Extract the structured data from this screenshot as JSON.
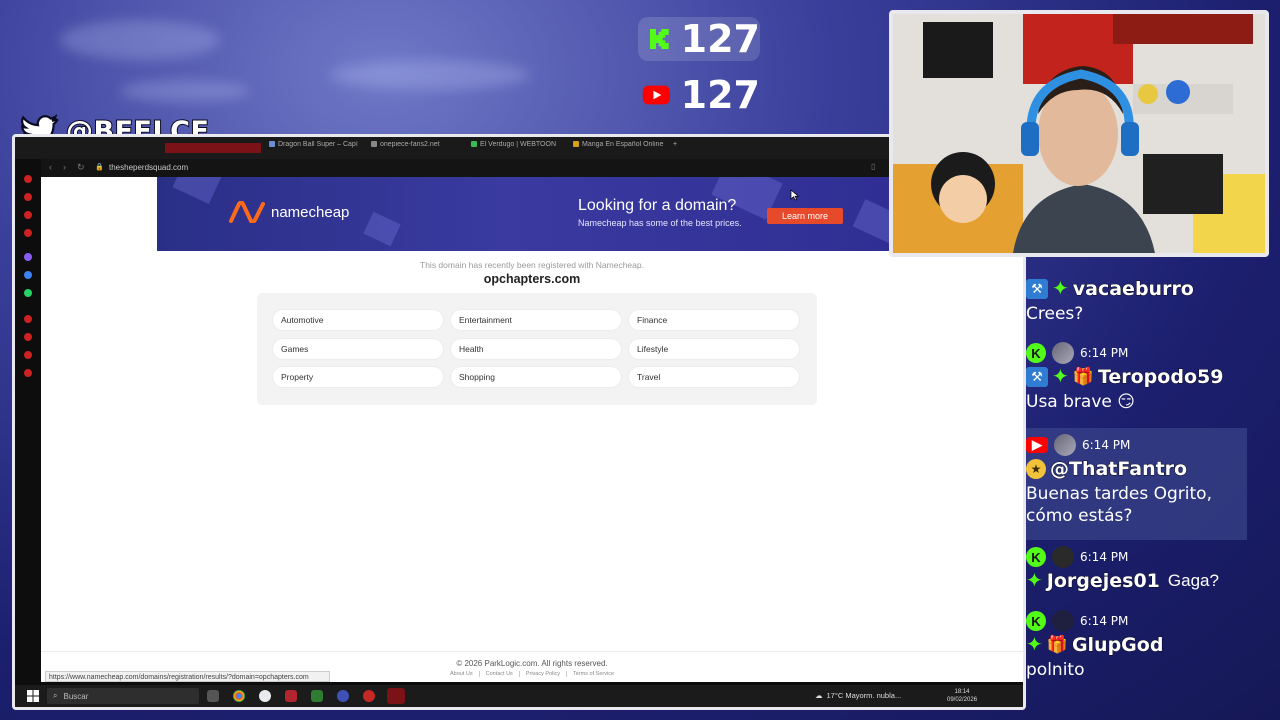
{
  "overlay": {
    "twitter_handle": "@BEELCE_",
    "kick_viewers": "127",
    "youtube_viewers": "127"
  },
  "browser": {
    "tabs": [
      {
        "label": ""
      },
      {
        "label": "Dragon Ball Super – Capí"
      },
      {
        "label": "onepiece-fans2.net"
      },
      {
        "label": "El Verdugo | WEBTOON"
      },
      {
        "label": "Manga En Español Online"
      }
    ],
    "url": "thesheperdsquad.com",
    "status_url": "https://www.namecheap.com/domains/registration/results/?domain=opchapters.com"
  },
  "page": {
    "banner": {
      "brand": "namecheap",
      "title": "Looking for a domain?",
      "subtitle": "Namecheap has some of the best prices.",
      "cta": "Learn more"
    },
    "registered_note": "This domain has recently been registered with Namecheap.",
    "domain": "opchapters.com",
    "categories": [
      "Automotive",
      "Entertainment",
      "Finance",
      "Games",
      "Health",
      "Lifestyle",
      "Property",
      "Shopping",
      "Travel"
    ],
    "copyright": "© 2026 ParkLogic.com. All rights reserved.",
    "footer_links": [
      "About Us",
      "Contact Us",
      "Privacy Policy",
      "Terms of Service"
    ]
  },
  "taskbar": {
    "search_placeholder": "Buscar",
    "weather": "17°C  Mayorm. nubla...",
    "time": "18:14",
    "date": "09/02/2026"
  },
  "chat": [
    {
      "platform": "",
      "time": "",
      "user": "vacaeburro",
      "text": "Crees?"
    },
    {
      "platform": "kick",
      "time": "6:14 PM",
      "user": "Teropodo59",
      "text": "Usa brave 😏"
    },
    {
      "platform": "youtube",
      "time": "6:14 PM",
      "user": "@ThatFantro",
      "text": "Buenas tardes Ogrito, cómo estás?"
    },
    {
      "platform": "kick",
      "time": "6:14 PM",
      "user": "Jorgejes01",
      "text": "Gaga?"
    },
    {
      "platform": "kick",
      "time": "6:14 PM",
      "user": "GlupGod",
      "text": "polnito"
    }
  ],
  "colors": {
    "kick_green": "#53fc18",
    "youtube_red": "#ff0000",
    "namecheap_orange": "#e64a2b",
    "banner_purple": "#2c2a8f"
  }
}
